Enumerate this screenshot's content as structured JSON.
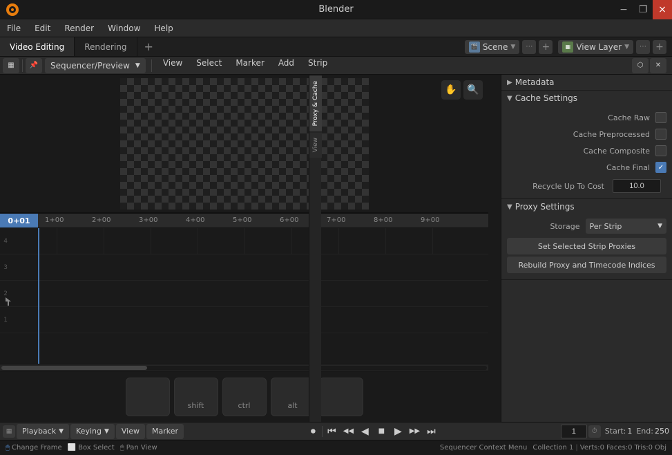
{
  "app": {
    "title": "Blender"
  },
  "titlebar": {
    "title": "Blender",
    "minimize": "−",
    "restore": "❐",
    "close": "×"
  },
  "menubar": {
    "items": [
      "File",
      "Edit",
      "Render",
      "Window",
      "Help"
    ]
  },
  "workspace": {
    "active_tab": "Video Editing",
    "tabs": [
      "Video Editing",
      "Rendering"
    ],
    "add_icon": "+",
    "scene_label": "Scene",
    "viewlayer_label": "View Layer"
  },
  "editor_toolbar": {
    "editor_type": "Sequencer/Preview",
    "menus": [
      "View",
      "Select",
      "Marker",
      "Add",
      "Strip"
    ]
  },
  "preview": {
    "tool_hand": "✋",
    "tool_zoom": "🔍"
  },
  "timeline": {
    "frame_current": "0+01",
    "ticks": [
      "1+00",
      "2+00",
      "3+00",
      "4+00",
      "5+00",
      "6+00",
      "7+00",
      "8+00",
      "9+00"
    ]
  },
  "right_panel": {
    "tabs": [
      "Proxy & Cache",
      "View"
    ],
    "sections": {
      "metadata": {
        "label": "Metadata",
        "collapsed": true
      },
      "cache_settings": {
        "label": "Cache Settings",
        "items": [
          {
            "label": "Cache Raw",
            "checked": false
          },
          {
            "label": "Cache Preprocessed",
            "checked": false
          },
          {
            "label": "Cache Composite",
            "checked": false
          },
          {
            "label": "Cache Final",
            "checked": true
          }
        ],
        "recycle_label": "Recycle Up To Cost",
        "recycle_value": "10.0"
      },
      "proxy_settings": {
        "label": "Proxy Settings",
        "storage_label": "Storage",
        "storage_value": "Per Strip",
        "buttons": [
          "Set Selected Strip Proxies",
          "Rebuild Proxy and Timecode Indices"
        ]
      }
    }
  },
  "bottom_bar": {
    "playback_label": "Playback",
    "keying_label": "Keying",
    "view_label": "View",
    "marker_label": "Marker",
    "frame_value": "1",
    "start_label": "Start:",
    "start_value": "1",
    "end_label": "End:",
    "end_value": "250",
    "record_btn": "⏺",
    "prev_keyframe": "⏮",
    "prev_frame": "◀◀",
    "play_reverse": "◀",
    "play": "▶",
    "next_frame": "▶▶",
    "next_keyframe": "⏭",
    "last_frame": "⏭"
  },
  "statusbar": {
    "change_frame": "Change Frame",
    "box_select": "Box Select",
    "pan_view": "Pan View",
    "context_menu": "Sequencer Context Menu",
    "collection": "Collection 1",
    "verts": "Verts:0",
    "faces": "Faces:0",
    "tris": "Tris:0",
    "obj": "Obj"
  },
  "keyboard_keys": [
    "",
    "shift",
    "ctrl",
    "alt",
    ""
  ],
  "tracks": [
    {
      "number": "4"
    },
    {
      "number": "3"
    },
    {
      "number": "2"
    },
    {
      "number": "1"
    }
  ]
}
